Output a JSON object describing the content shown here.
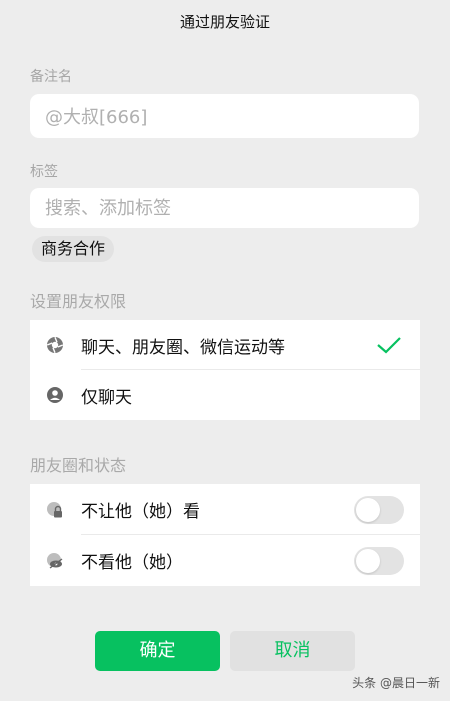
{
  "header": {
    "title": "通过朋友验证"
  },
  "remark": {
    "label": "备注名",
    "value": "@大叔[666]"
  },
  "tags": {
    "label": "标签",
    "placeholder": "搜索、添加标签",
    "chips": [
      "商务合作"
    ]
  },
  "permissions": {
    "label": "设置朋友权限",
    "options": [
      {
        "label": "聊天、朋友圈、微信运动等",
        "selected": true,
        "icon": "aperture-icon"
      },
      {
        "label": "仅聊天",
        "selected": false,
        "icon": "chat-user-icon"
      }
    ]
  },
  "moments": {
    "label": "朋友圈和状态",
    "items": [
      {
        "label": "不让他（她）看",
        "on": false,
        "icon": "lock-icon"
      },
      {
        "label": "不看他（她）",
        "on": false,
        "icon": "hide-icon"
      }
    ]
  },
  "actions": {
    "confirm": "确定",
    "cancel": "取消"
  },
  "watermark": "头条 @晨日一新",
  "colors": {
    "accent": "#07c160",
    "background": "#ededed"
  }
}
